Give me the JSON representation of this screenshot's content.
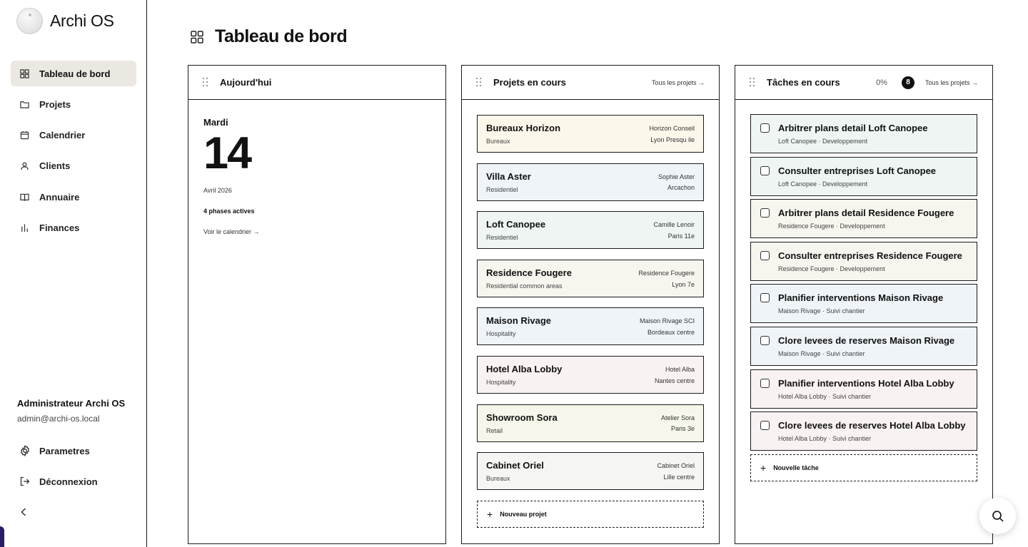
{
  "brand": {
    "name": "Archi OS"
  },
  "sidebar": {
    "items": [
      {
        "label": "Tableau de bord",
        "icon": "grid-icon",
        "active": true
      },
      {
        "label": "Projets",
        "icon": "folder-icon",
        "active": false
      },
      {
        "label": "Calendrier",
        "icon": "calendar-icon",
        "active": false
      },
      {
        "label": "Clients",
        "icon": "user-icon",
        "active": false
      },
      {
        "label": "Annuaire",
        "icon": "book-icon",
        "active": false
      },
      {
        "label": "Finances",
        "icon": "bar-chart-icon",
        "active": false
      }
    ],
    "user": {
      "name": "Administrateur Archi OS",
      "email": "admin@archi-os.local"
    },
    "settings_label": "Parametres",
    "logout_label": "Déconnexion"
  },
  "page": {
    "title": "Tableau de bord"
  },
  "today": {
    "title": "Aujourd'hui",
    "day_name": "Mardi",
    "day_number": "14",
    "month": "Avril 2026",
    "phases": "4 phases actives",
    "calendar_link": "Voir le calendrier →"
  },
  "projects": {
    "title": "Projets en cours",
    "link": "Tous les projets →",
    "new_label": "Nouveau projet",
    "items": [
      {
        "name": "Bureaux Horizon",
        "type": "Bureaux",
        "client": "Horizon Conseil",
        "location": "Lyon Presqu ile",
        "color": "#fbf7ea"
      },
      {
        "name": "Villa Aster",
        "type": "Residentiel",
        "client": "Sophie Aster",
        "location": "Arcachon",
        "color": "#eef4f7"
      },
      {
        "name": "Loft Canopee",
        "type": "Residentiel",
        "client": "Camille Lenoir",
        "location": "Paris 11e",
        "color": "#eef5f3"
      },
      {
        "name": "Residence Fougere",
        "type": "Residential common areas",
        "client": "Residence Fougere",
        "location": "Lyon 7e",
        "color": "#f6f5ee"
      },
      {
        "name": "Maison Rivage",
        "type": "Hospitality",
        "client": "Maison Rivage SCI",
        "location": "Bordeaux centre",
        "color": "#eff4f8"
      },
      {
        "name": "Hotel Alba Lobby",
        "type": "Hospitality",
        "client": "Hotel Alba",
        "location": "Nantes centre",
        "color": "#f9f2f2"
      },
      {
        "name": "Showroom Sora",
        "type": "Retail",
        "client": "Atelier Sora",
        "location": "Paris 3e",
        "color": "#f6f7ea"
      },
      {
        "name": "Cabinet Oriel",
        "type": "Bureaux",
        "client": "Cabinet Oriel",
        "location": "Lille centre",
        "color": "#f5f5f3"
      }
    ]
  },
  "tasks": {
    "title": "Tâches en cours",
    "percent": "0%",
    "count": "8",
    "link": "Tous les projets →",
    "new_label": "Nouvelle tâche",
    "items": [
      {
        "title": "Arbitrer plans detail Loft Canopee",
        "meta": "Loft Canopee · Developpement",
        "color": "#eef5f3"
      },
      {
        "title": "Consulter entreprises Loft Canopee",
        "meta": "Loft Canopee · Developpement",
        "color": "#eef5f3"
      },
      {
        "title": "Arbitrer plans detail Residence Fougere",
        "meta": "Residence Fougere · Developpement",
        "color": "#f6f5ee"
      },
      {
        "title": "Consulter entreprises Residence Fougere",
        "meta": "Residence Fougere · Developpement",
        "color": "#f6f5ee"
      },
      {
        "title": "Planifier interventions Maison Rivage",
        "meta": "Maison Rivage · Suivi chantier",
        "color": "#eff4f8"
      },
      {
        "title": "Clore levees de reserves Maison Rivage",
        "meta": "Maison Rivage · Suivi chantier",
        "color": "#eff4f8"
      },
      {
        "title": "Planifier interventions Hotel Alba Lobby",
        "meta": "Hotel Alba Lobby · Suivi chantier",
        "color": "#f9f2f2"
      },
      {
        "title": "Clore levees de reserves Hotel Alba Lobby",
        "meta": "Hotel Alba Lobby · Suivi chantier",
        "color": "#f9f2f2"
      }
    ]
  },
  "search_button": {
    "icon": "search-icon"
  }
}
